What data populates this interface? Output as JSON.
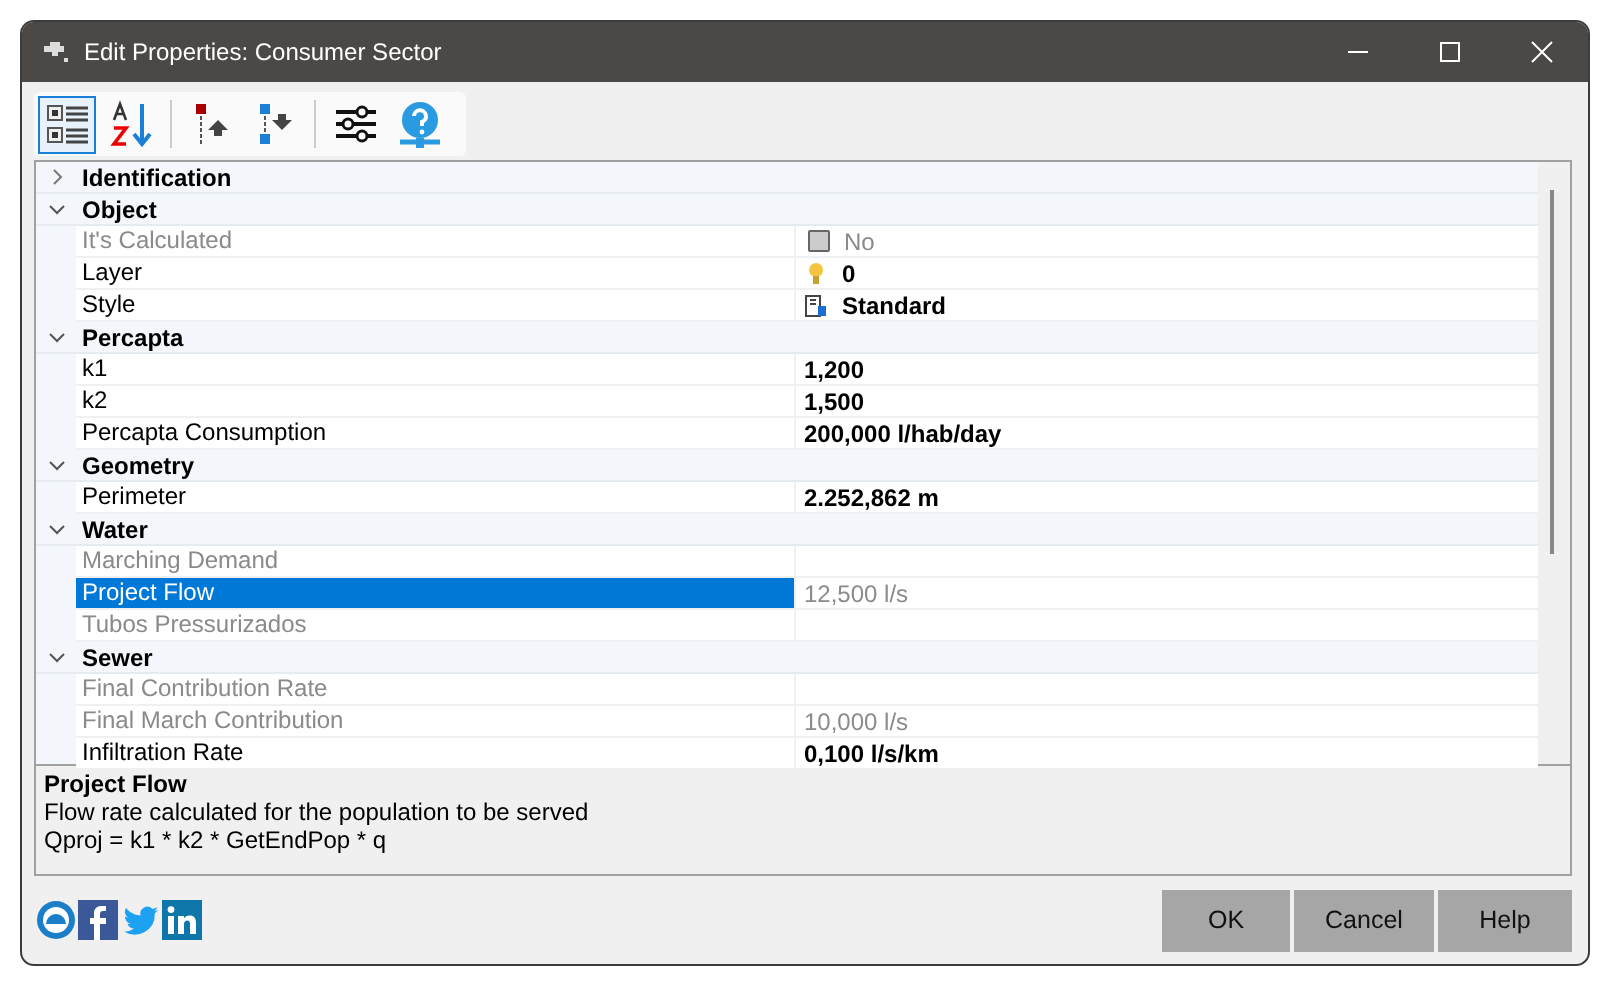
{
  "window": {
    "title": "Edit Properties: Consumer Sector"
  },
  "toolbar": [
    {
      "kind": "categorized",
      "selected": true
    },
    {
      "kind": "alphabetical",
      "selected": false
    },
    {
      "kind": "separator"
    },
    {
      "kind": "move-up",
      "selected": false
    },
    {
      "kind": "move-down",
      "selected": false
    },
    {
      "kind": "separator"
    },
    {
      "kind": "settings",
      "selected": false
    },
    {
      "kind": "help",
      "selected": false
    }
  ],
  "categories": [
    {
      "name": "Identification",
      "expanded": false
    },
    {
      "name": "Object",
      "expanded": true,
      "items": [
        {
          "label": "It's Calculated",
          "value": "No",
          "disabled": true,
          "selected": false,
          "kind": "checkbox",
          "checked": false
        },
        {
          "label": "Layer",
          "value": "0",
          "disabled": false,
          "selected": false,
          "kind": "bulb"
        },
        {
          "label": "Style",
          "value": "Standard",
          "disabled": false,
          "selected": false,
          "kind": "style"
        }
      ]
    },
    {
      "name": "Percapta",
      "expanded": true,
      "items": [
        {
          "label": "k1",
          "value": "1,200",
          "disabled": false,
          "selected": false,
          "kind": "text"
        },
        {
          "label": "k2",
          "value": "1,500",
          "disabled": false,
          "selected": false,
          "kind": "text"
        },
        {
          "label": "Percapta Consumption",
          "value": "200,000 l/hab/day",
          "disabled": false,
          "selected": false,
          "kind": "text"
        }
      ]
    },
    {
      "name": "Geometry",
      "expanded": true,
      "items": [
        {
          "label": "Perimeter",
          "value": "2.252,862 m",
          "disabled": false,
          "selected": false,
          "kind": "text"
        }
      ]
    },
    {
      "name": "Water",
      "expanded": true,
      "items": [
        {
          "label": "Marching Demand",
          "disabled": true,
          "selected": false,
          "kind": "text"
        },
        {
          "label": "Project Flow",
          "value": "12,500 l/s",
          "disabled": true,
          "selected": true,
          "kind": "text"
        },
        {
          "label": "Tubos Pressurizados",
          "disabled": true,
          "selected": false,
          "kind": "text"
        }
      ]
    },
    {
      "name": "Sewer",
      "expanded": true,
      "items": [
        {
          "label": "Final Contribution Rate",
          "disabled": true,
          "selected": false,
          "kind": "text"
        },
        {
          "label": "Final March Contribution",
          "value": "10,000 l/s",
          "disabled": true,
          "selected": false,
          "kind": "text"
        },
        {
          "label": "Infiltration Rate",
          "value": "0,100 l/s/km",
          "disabled": false,
          "selected": false,
          "kind": "text"
        }
      ]
    }
  ],
  "description": {
    "title": "Project Flow",
    "lines": [
      "Flow rate calculated for the population to be served",
      "Qproj = k1 * k2 * GetEndPop * q"
    ]
  },
  "social": [
    {
      "kind": "logo"
    },
    {
      "kind": "facebook"
    },
    {
      "kind": "twitter"
    },
    {
      "kind": "linkedin"
    }
  ],
  "buttons": [
    "OK",
    "Cancel",
    "Help"
  ]
}
